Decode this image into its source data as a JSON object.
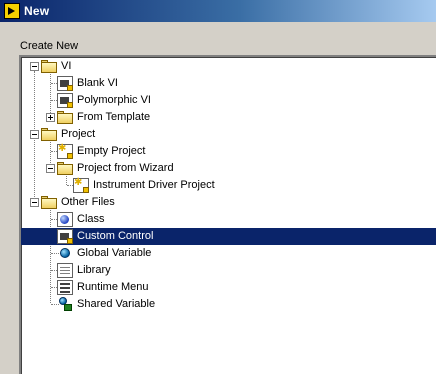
{
  "window": {
    "title": "New"
  },
  "create_new_label": "Create New",
  "tree": {
    "vi": "VI",
    "blank_vi": "Blank VI",
    "polymorphic_vi": "Polymorphic VI",
    "from_template": "From Template",
    "project": "Project",
    "empty_project": "Empty Project",
    "project_from_wizard": "Project from Wizard",
    "instrument_driver_project": "Instrument Driver Project",
    "other_files": "Other Files",
    "class": "Class",
    "custom_control": "Custom Control",
    "global_variable": "Global Variable",
    "library": "Library",
    "runtime_menu": "Runtime Menu",
    "shared_variable": "Shared Variable"
  },
  "selected_item": "Custom Control",
  "colors": {
    "selection": "#0a246a",
    "titlebar_start": "#0a246a",
    "titlebar_end": "#a6caf0"
  }
}
